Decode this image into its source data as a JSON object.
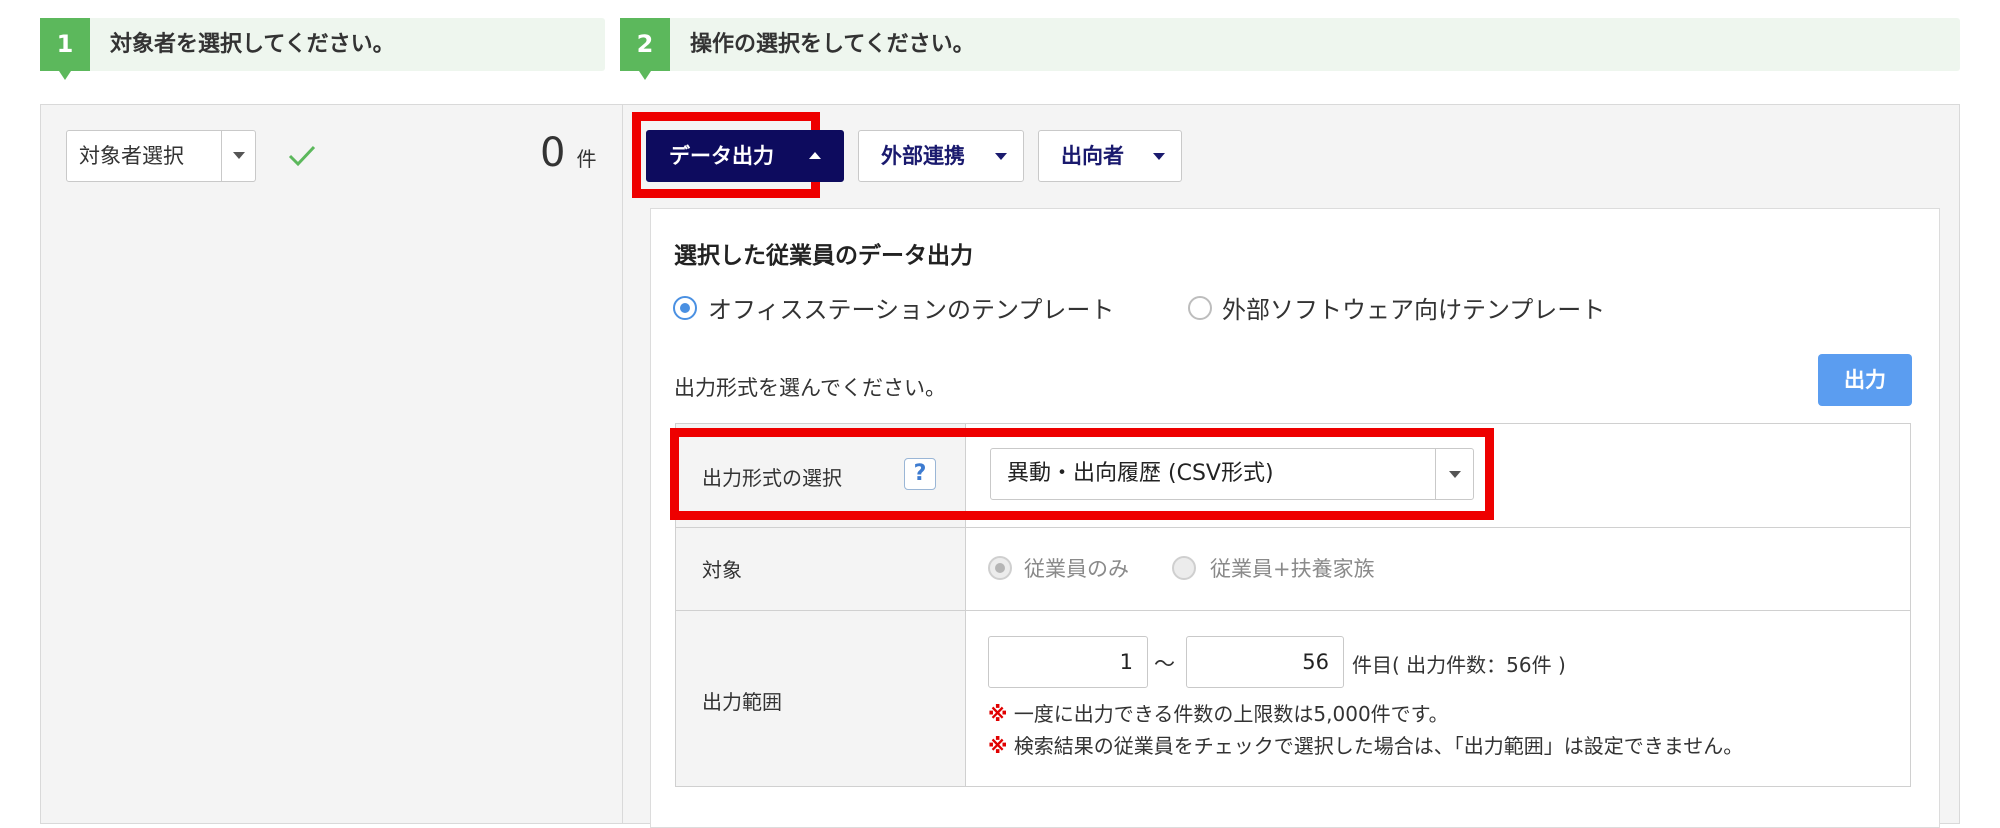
{
  "steps": {
    "step1": {
      "number": "1",
      "label": "対象者を選択してください。"
    },
    "step2": {
      "number": "2",
      "label": "操作の選択をしてください。"
    }
  },
  "left_panel": {
    "target_select_label": "対象者選択",
    "count_value": "0",
    "count_unit": "件",
    "check_icon": "check-icon"
  },
  "tabs": [
    {
      "label": "データ出力",
      "active": true,
      "icon": "caret-up-icon"
    },
    {
      "label": "外部連携",
      "active": false,
      "icon": "caret-down-icon"
    },
    {
      "label": "出向者",
      "active": false,
      "icon": "caret-down-icon"
    }
  ],
  "export_card": {
    "title": "選択した従業員のデータ出力",
    "template_options": [
      {
        "label": "オフィスステーションのテンプレート",
        "selected": true
      },
      {
        "label": "外部ソフトウェア向けテンプレート",
        "selected": false
      }
    ],
    "format_prompt": "出力形式を選んでください。",
    "output_button": "出力",
    "rows": {
      "format": {
        "label": "出力形式の選択",
        "help": "?",
        "selected_value": "異動・出向履歴 (CSV形式)"
      },
      "target": {
        "label": "対象",
        "options": [
          {
            "label": "従業員のみ",
            "selected": true,
            "disabled": true
          },
          {
            "label": "従業員+扶養家族",
            "selected": false,
            "disabled": true
          }
        ]
      },
      "range": {
        "label": "出力範囲",
        "from_value": "1",
        "separator": "〜",
        "to_value": "56",
        "suffix": "件目( 出力件数：56件 )",
        "note_mark": "※",
        "note1": "一度に出力できる件数の上限数は5,000件です。",
        "note2": "検索結果の従業員をチェックで選択した場合は、「出力範囲」は設定できません。"
      }
    }
  },
  "colors": {
    "step_green": "#5cb85c",
    "active_tab": "#0d0b5e",
    "highlight_red": "#ee0000",
    "output_button": "#5b9df0"
  }
}
